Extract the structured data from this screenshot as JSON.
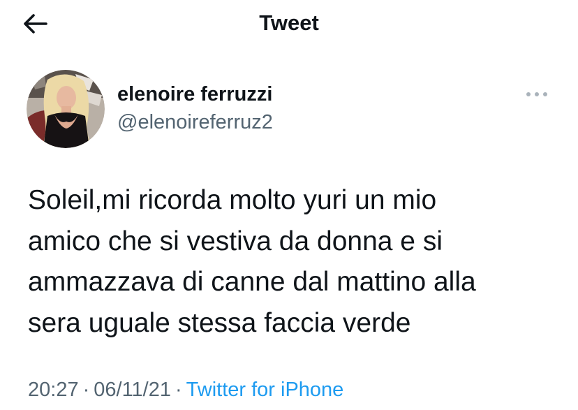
{
  "header": {
    "back_icon": "arrow-left-icon",
    "title": "Tweet"
  },
  "tweet": {
    "author": {
      "display_name": "elenoire ferruzzi",
      "handle": "@elenoireferruz2",
      "avatar_icon": "profile-photo"
    },
    "more_icon": "more-horizontal-icon",
    "text": "Soleil,mi ricorda molto yuri un mio\namico che si vestiva da donna e si\nammazzava di canne dal mattino alla\nsera uguale stessa faccia verde",
    "time": "20:27",
    "date": "06/11/21",
    "separator": "·",
    "source": "Twitter for iPhone"
  },
  "colors": {
    "text_primary": "#0f1419",
    "text_secondary": "#536471",
    "accent": "#1d9bf0",
    "background": "#ffffff"
  }
}
